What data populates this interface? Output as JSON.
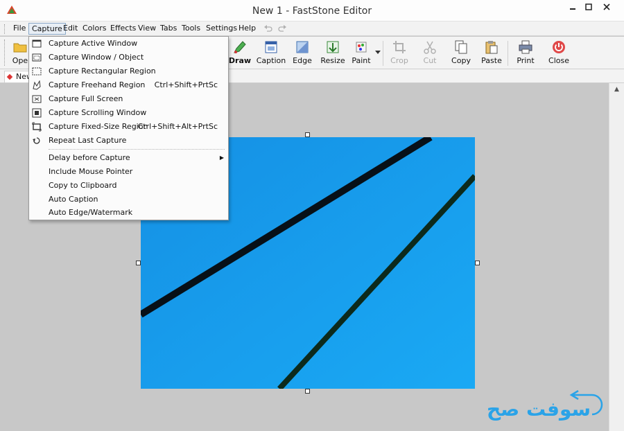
{
  "window": {
    "title": "New 1 - FastStone Editor",
    "minimize_label": "▫",
    "maximize_label": "□",
    "close_label": "✕"
  },
  "menubar": {
    "items": [
      "File",
      "Capture",
      "Edit",
      "Colors",
      "Effects",
      "View",
      "Tabs",
      "Tools",
      "Settings",
      "Help"
    ],
    "active": "Capture"
  },
  "toolbar": {
    "open_label": "Ope",
    "draw_label": "Draw",
    "caption_label": "Caption",
    "edge_label": "Edge",
    "resize_label": "Resize",
    "paint_label": "Paint",
    "crop_label": "Crop",
    "cut_label": "Cut",
    "copy_label": "Copy",
    "paste_label": "Paste",
    "print_label": "Print",
    "close_label": "Close"
  },
  "tabs": {
    "current": "New"
  },
  "capture_menu": {
    "items": [
      {
        "label": "Capture Active Window",
        "shortcut": "",
        "icon": "window-icon"
      },
      {
        "label": "Capture Window / Object",
        "shortcut": "",
        "icon": "window-object-icon"
      },
      {
        "label": "Capture Rectangular Region",
        "shortcut": "",
        "icon": "rect-region-icon"
      },
      {
        "label": "Capture Freehand Region",
        "shortcut": "Ctrl+Shift+PrtSc",
        "icon": "freehand-icon"
      },
      {
        "label": "Capture Full Screen",
        "shortcut": "",
        "icon": "fullscreen-icon"
      },
      {
        "label": "Capture Scrolling Window",
        "shortcut": "",
        "icon": "scrolling-icon"
      },
      {
        "label": "Capture Fixed-Size Region",
        "shortcut": "Ctrl+Shift+Alt+PrtSc",
        "icon": "fixed-size-icon"
      },
      {
        "label": "Repeat Last Capture",
        "shortcut": "",
        "icon": "repeat-icon"
      }
    ],
    "options": [
      {
        "label": "Delay before Capture",
        "submenu": true
      },
      {
        "label": "Include Mouse Pointer"
      },
      {
        "label": "Copy to Clipboard"
      },
      {
        "label": "Auto Caption"
      },
      {
        "label": "Auto Edge/Watermark"
      }
    ]
  },
  "watermark": {
    "text": "سوفت صح",
    "color": "#2aa3e8"
  },
  "colors": {
    "image_background": "#1a9ff0",
    "canvas": "#c8c8c8"
  }
}
